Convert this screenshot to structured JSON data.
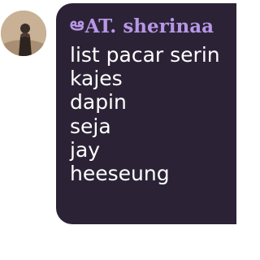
{
  "message": {
    "sender_prefix": "ఆ",
    "sender_name": "AT. sherinaa",
    "lines": [
      "list pacar serin",
      "kajes",
      "dapin",
      "seja",
      "jay",
      "heeseung"
    ]
  },
  "colors": {
    "bubble_background": "#2b2335",
    "sender_name": "#b896e6",
    "message_text": "#ffffff"
  }
}
